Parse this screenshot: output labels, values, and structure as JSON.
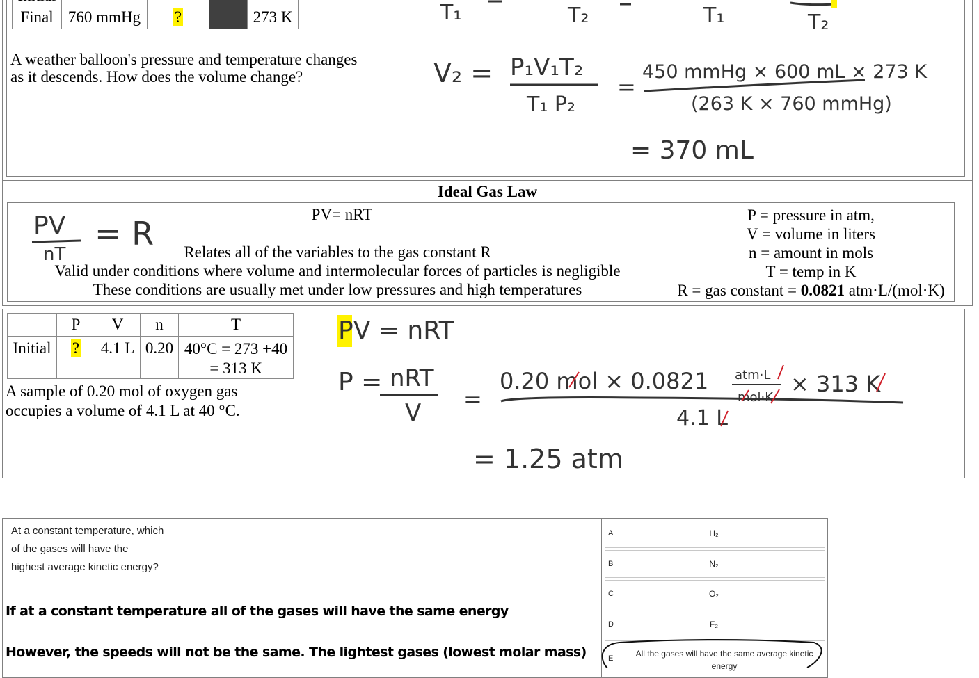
{
  "combined_law_example": {
    "table_partial_row_label": "Initial",
    "final_row": {
      "label": "Final",
      "pressure": "760 mmHg",
      "volume": "?",
      "moles": "",
      "temperature": "273 K"
    },
    "problem_text_line1": "A weather balloon's pressure and temperature changes",
    "problem_text_line2": "as it descends. How does the volume change?",
    "handwriting": {
      "top_fragments": [
        "T₁",
        "T₂",
        "T₁",
        "T₂"
      ],
      "v2_formula_lhs": "V₂ =",
      "v2_formula_num": "P₁V₁T₂",
      "v2_formula_den": "T₁ P₂",
      "v2_sub_num": "450 mmHg × 600 mL × 273 K",
      "v2_sub_den": "(263 K × 760 mmHg)",
      "v2_result": "= 370 mL"
    }
  },
  "ideal_gas_law": {
    "title": "Ideal Gas Law",
    "equation": "PV= nRT",
    "handwritten_num": "PV",
    "handwritten_den": "nT",
    "handwritten_rhs": "= R",
    "description_lines": [
      "Relates all of the variables to the gas constant R",
      "Valid under conditions where volume and intermolecular forces of particles is negligible",
      "These conditions are usually met under low pressures and high temperatures"
    ],
    "variables": [
      "P = pressure in atm,",
      "V = volume in liters",
      "n = amount in mols",
      "T = temp in K"
    ],
    "r_constant_prefix": "R = gas constant = ",
    "r_constant_value": "0.0821",
    "r_constant_units": " atm·L/(mol·K)"
  },
  "ideal_gas_example": {
    "headers": [
      "",
      "P",
      "V",
      "n",
      "T"
    ],
    "row": {
      "label": "Initial",
      "pressure": "?",
      "volume": "4.1 L",
      "moles": "0.20",
      "temperature_line1": "40°C = 273 +40",
      "temperature_line2": "= 313 K"
    },
    "problem_line1": "A sample of 0.20 mol of oxygen gas",
    "problem_line2": "occupies a volume of 4.1 L at 40 °C.",
    "handwriting": {
      "eq1": "PV = nRT",
      "eq2_lhs": "P =",
      "eq2_num": "nRT",
      "eq2_den": "V",
      "sub_num_a": "0.20 mol × 0.0821",
      "units_num": "atm·L",
      "units_den": "mol·K",
      "sub_num_b": "× 313 K",
      "sub_den": "4.1 L",
      "result": "= 1.25 atm"
    }
  },
  "kinetic_question": {
    "question_lines": [
      "At a constant temperature, which",
      "of the gases will have the",
      "highest average kinetic energy?"
    ],
    "explanation_1": "If at a constant temperature all of the gases will have the same energy",
    "explanation_2": "However, the speeds will not be the same. The lightest gases (lowest molar mass)",
    "options": [
      {
        "letter": "A",
        "text": "H₂"
      },
      {
        "letter": "B",
        "text": "N₂"
      },
      {
        "letter": "C",
        "text": "O₂"
      },
      {
        "letter": "D",
        "text": "F₂"
      },
      {
        "letter": "E",
        "text": "All the gases will have the same average kinetic energy"
      }
    ],
    "selected_option": "E"
  },
  "colors": {
    "highlight": "#fff200",
    "ink": "#333333",
    "strike": "#d0202a",
    "border": "#808080",
    "dark_cell": "#404040"
  }
}
